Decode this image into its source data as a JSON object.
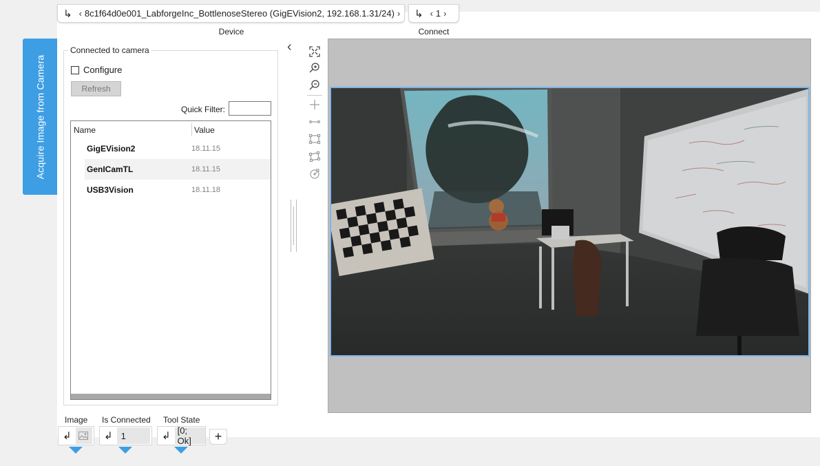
{
  "side_tab": {
    "label": "Acquire Image from Camera"
  },
  "device_input": {
    "value": "8c1f64d0e001_LabforgeInc_BottlenoseStereo (GigEVision2, 192.168.1.31/24)",
    "caption": "Device"
  },
  "connect_input": {
    "value": "1",
    "caption": "Connect"
  },
  "group": {
    "title": "Connected to camera",
    "configure_label": "Configure",
    "configure_checked": false,
    "refresh_label": "Refresh",
    "quick_filter_label": "Quick Filter:",
    "quick_filter_value": ""
  },
  "table": {
    "columns": [
      "Name",
      "Value"
    ],
    "rows": [
      {
        "name": "GigEVision2",
        "value": "18.11.15"
      },
      {
        "name": "GenICamTL",
        "value": "18.11.15"
      },
      {
        "name": "USB3Vision",
        "value": "18.11.18"
      }
    ]
  },
  "toolbar": {
    "icons": [
      "fit-to-window-icon",
      "zoom-in-icon",
      "zoom-out-icon",
      "point-tool-icon",
      "segment-tool-icon",
      "rectangle-tool-icon",
      "rotated-rectangle-tool-icon",
      "circle-tool-icon"
    ]
  },
  "outputs": {
    "image_caption": "Image",
    "is_connected_caption": "Is Connected",
    "is_connected_value": "1",
    "tool_state_caption": "Tool State",
    "tool_state_value": "[0; Ok]"
  },
  "colors": {
    "accent": "#3d9ee4",
    "image_border": "#7cb4ea",
    "viewer_bg": "#c0c0c0"
  }
}
